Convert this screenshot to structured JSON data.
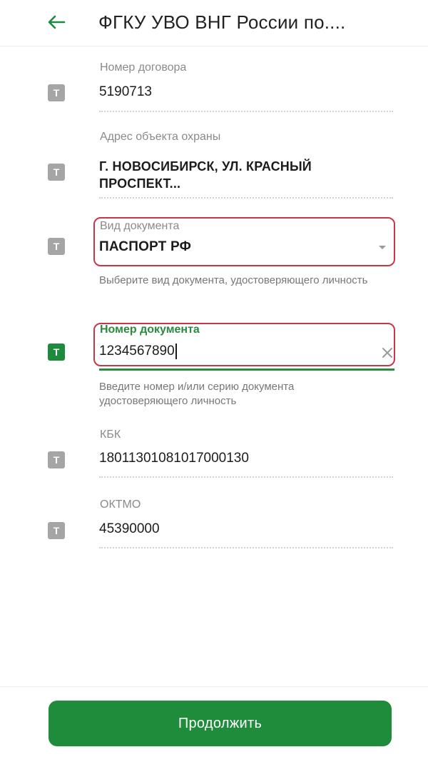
{
  "header": {
    "title": "ФГКУ УВО ВНГ России по....",
    "back_icon": "arrow-left-icon",
    "accent": "#1e8a3e"
  },
  "fields": {
    "contract": {
      "label": "Номер договора",
      "value": "5190713"
    },
    "address": {
      "label": "Адрес объекта охраны",
      "value_line1": "Г. НОВОСИБИРСК, УЛ. КРАСНЫЙ",
      "value_line2": "ПРОСПЕКТ..."
    },
    "doc_type": {
      "label": "Вид документа",
      "value": "ПАСПОРТ РФ",
      "hint": "Выберите вид документа, удостоверяющего личность"
    },
    "doc_number": {
      "label": "Номер документа",
      "value": "1234567890",
      "hint": "Введите номер и/или серию документа удостоверяющего личность"
    },
    "kbk": {
      "label": "КБК",
      "value": "18011301081017000130"
    },
    "oktmo": {
      "label": "ОКТМО",
      "value": "45390000"
    }
  },
  "field_icon_glyph": "T",
  "footer": {
    "continue_label": "Продолжить"
  },
  "colors": {
    "highlight_border": "#c8364a",
    "button": "#1f8c3b",
    "icon_inactive": "#a5a5a5"
  }
}
